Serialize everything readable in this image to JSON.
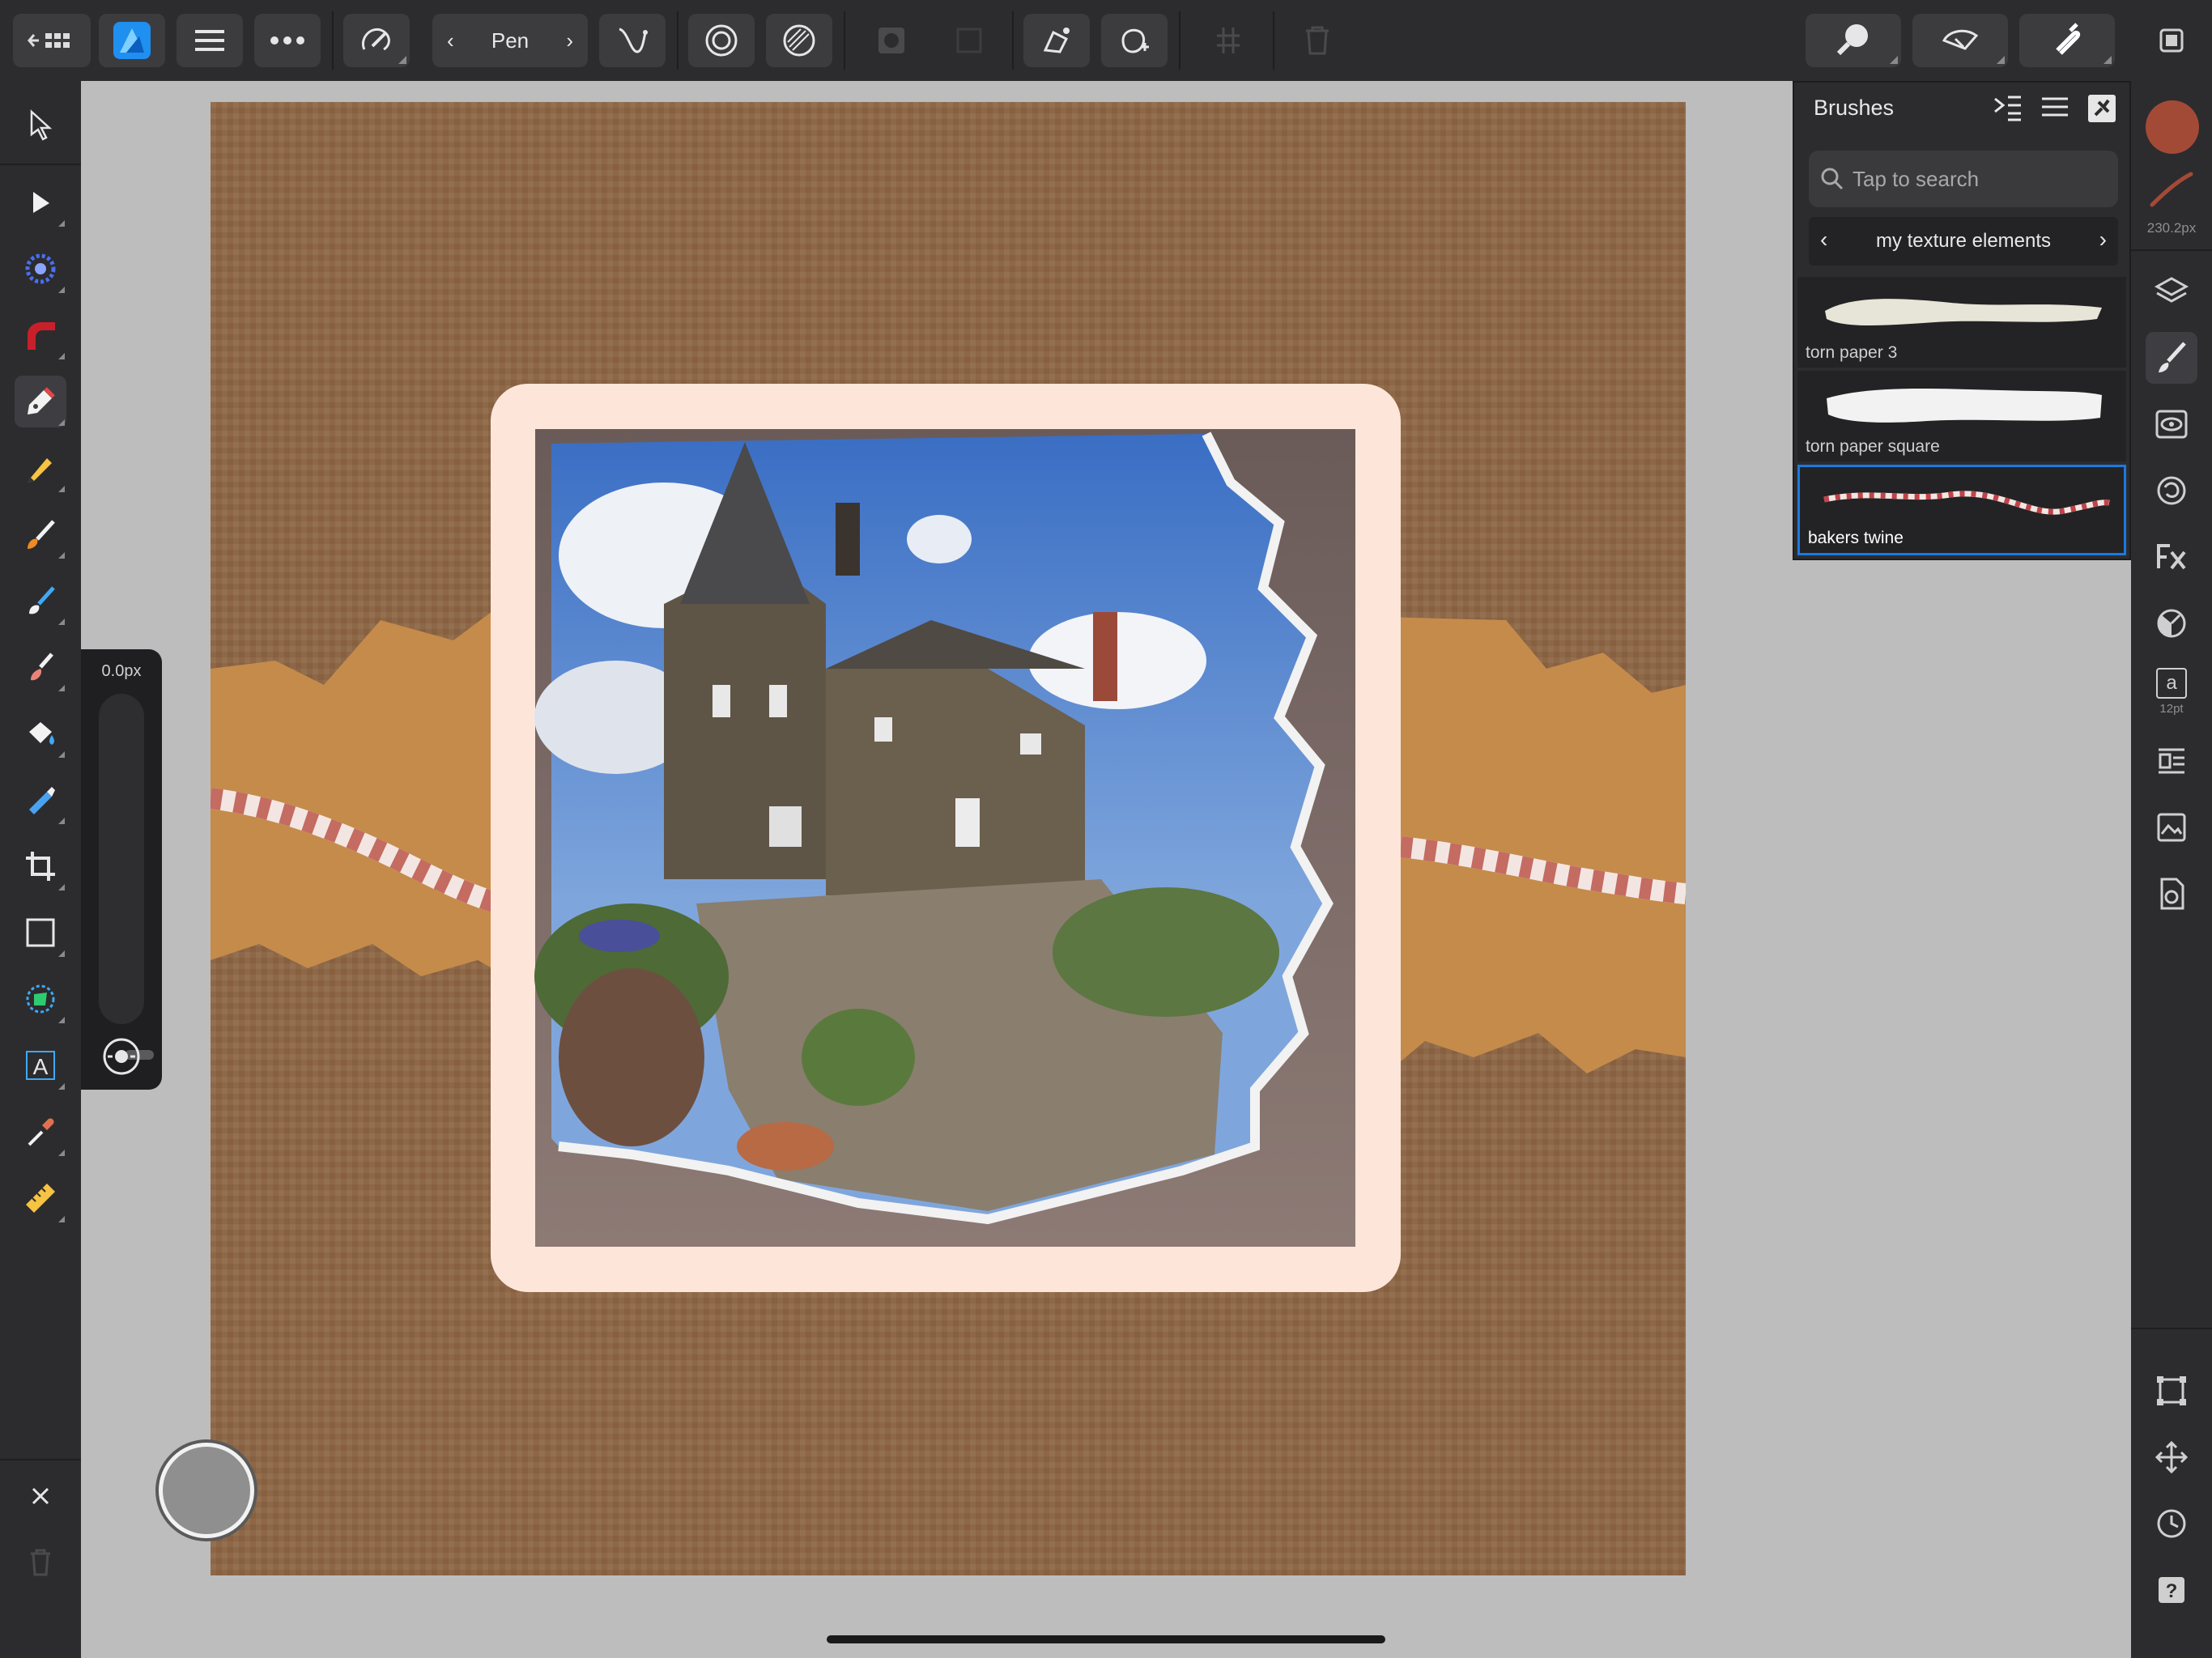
{
  "toolbar": {
    "tool_name": "Pen"
  },
  "slider": {
    "value": "0.0px"
  },
  "brushes_panel": {
    "title": "Brushes",
    "search_placeholder": "Tap to search",
    "category": "my texture elements",
    "items": [
      {
        "name": "torn paper 3",
        "selected": false
      },
      {
        "name": "torn paper square",
        "selected": false
      },
      {
        "name": "bakers twine",
        "selected": true
      }
    ]
  },
  "right_panel": {
    "color_swatch": "#a34a37",
    "brush_size": "230.2px",
    "text_size": "12pt",
    "text_icon_glyph": "a"
  },
  "colors": {
    "accent": "#1a7ae0",
    "affinity_logo": "#1f8ff0",
    "kraft_paper": "#c9904f",
    "frame": "#fde6d9"
  }
}
